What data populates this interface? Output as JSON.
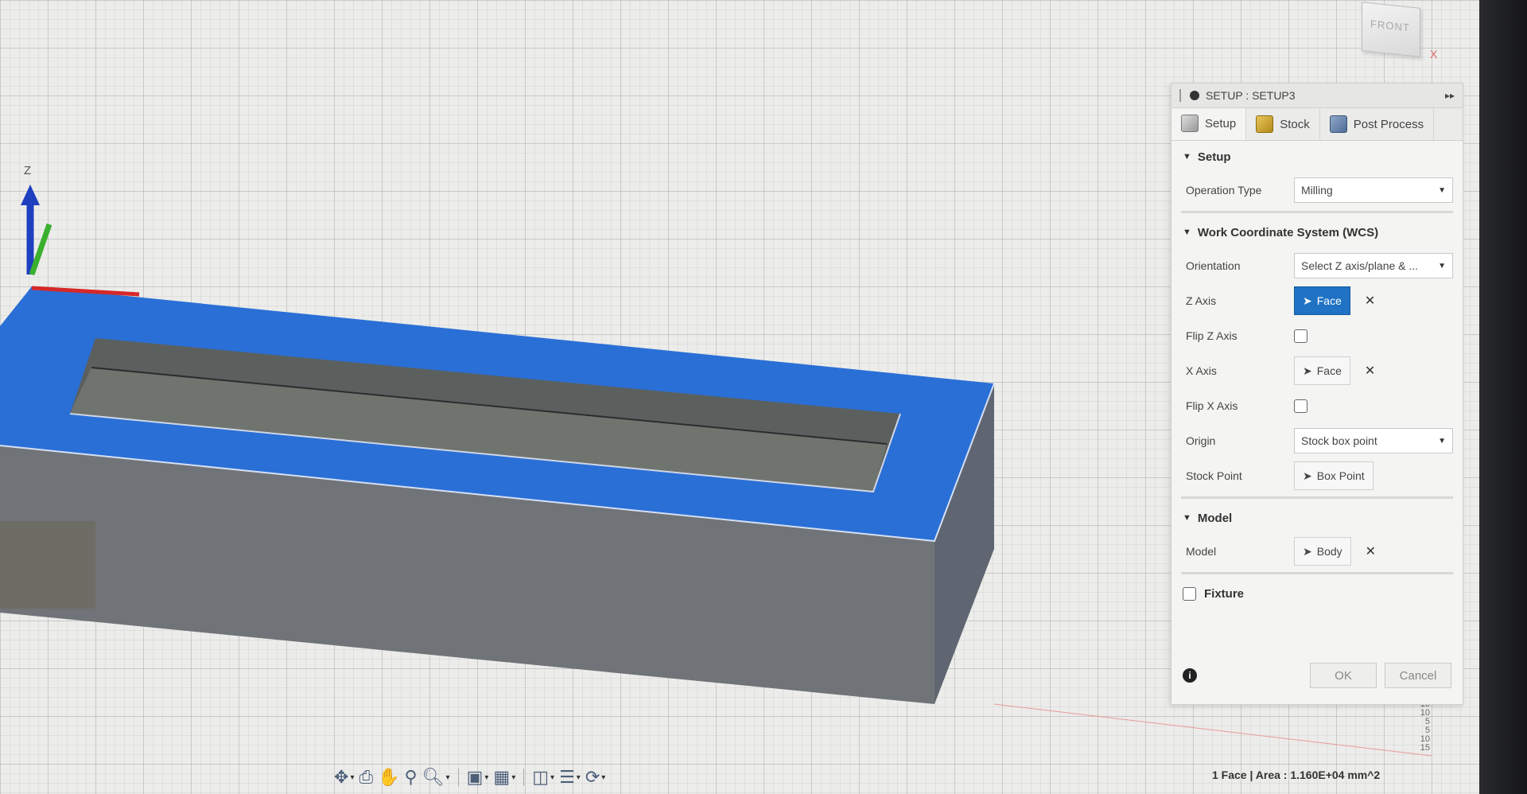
{
  "viewcube": {
    "face": "FRONT",
    "axis": "X"
  },
  "axes": {
    "z": "Z"
  },
  "panel": {
    "title": "SETUP : SETUP3",
    "tabs": [
      {
        "label": "Setup",
        "icon": "setup-icon"
      },
      {
        "label": "Stock",
        "icon": "stock-icon"
      },
      {
        "label": "Post Process",
        "icon": "post-process-icon"
      }
    ],
    "setup_section": {
      "title": "Setup",
      "operation_type_label": "Operation Type",
      "operation_type_value": "Milling"
    },
    "wcs_section": {
      "title": "Work Coordinate System (WCS)",
      "orientation_label": "Orientation",
      "orientation_value": "Select Z axis/plane & ...",
      "z_axis_label": "Z Axis",
      "z_axis_value": "Face",
      "flip_z_label": "Flip Z Axis",
      "x_axis_label": "X Axis",
      "x_axis_value": "Face",
      "flip_x_label": "Flip X Axis",
      "origin_label": "Origin",
      "origin_value": "Stock box point",
      "stock_point_label": "Stock Point",
      "stock_point_value": "Box Point"
    },
    "model_section": {
      "title": "Model",
      "model_label": "Model",
      "model_value": "Body"
    },
    "fixture_label": "Fixture",
    "ok_label": "OK",
    "cancel_label": "Cancel"
  },
  "status": {
    "text": "1 Face | Area : 1.160E+04 mm^2"
  },
  "ruler": {
    "ticks": [
      "15",
      "10",
      "5",
      "5",
      "10",
      "15"
    ]
  },
  "colors": {
    "top_face": "#2a6fd6",
    "selection_blue": "#1f72c4",
    "body_gray": "#6e7276"
  }
}
